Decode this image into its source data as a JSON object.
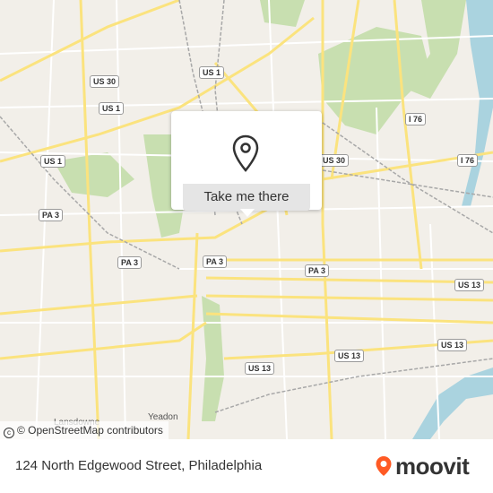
{
  "map": {
    "route_shields": [
      {
        "label": "US 30",
        "pos": "top-left"
      },
      {
        "label": "US 1",
        "pos": "upper-middle"
      },
      {
        "label": "US 1",
        "pos": "upper-left"
      },
      {
        "label": "US 1",
        "pos": "left"
      },
      {
        "label": "I 76",
        "pos": "top-right"
      },
      {
        "label": "I 76",
        "pos": "right"
      },
      {
        "label": "US 30",
        "pos": "center-right"
      },
      {
        "label": "PA 3",
        "pos": "left-a"
      },
      {
        "label": "PA 3",
        "pos": "left-b"
      },
      {
        "label": "PA 3",
        "pos": "center-a"
      },
      {
        "label": "PA 3",
        "pos": "center-b"
      },
      {
        "label": "US 13",
        "pos": "right-a"
      },
      {
        "label": "US 13",
        "pos": "right-b"
      },
      {
        "label": "US 13",
        "pos": "center-lower"
      },
      {
        "label": "US 13",
        "pos": "lower-middle"
      }
    ],
    "places": [
      "Lansdowne",
      "Yeadon"
    ],
    "attribution": "© OpenStreetMap contributors",
    "colors": {
      "land": "#f2efe9",
      "park": "#c8dfb0",
      "water": "#aad3df",
      "road": "#fbe37e",
      "road_casing": "#e6c95a",
      "rail": "#a8a8a8"
    }
  },
  "popup": {
    "pin_icon": "map-pin-icon",
    "button_label": "Take me there"
  },
  "footer": {
    "address": "124 North Edgewood Street, Philadelphia",
    "logo_icon": "moovit-pin-icon",
    "logo_text": "moovit",
    "brand_color": "#ff5a24"
  }
}
